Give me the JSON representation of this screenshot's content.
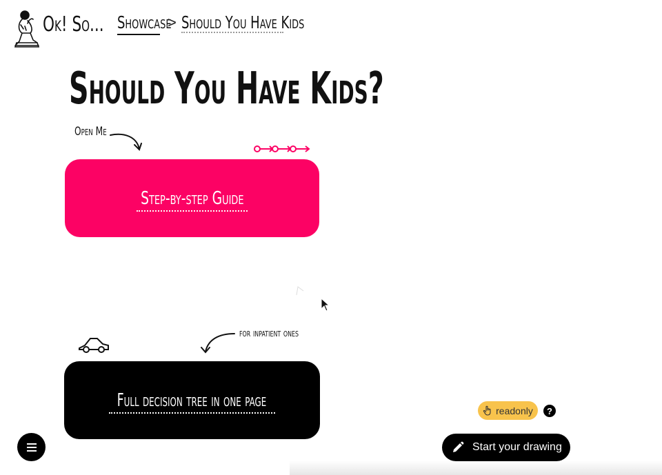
{
  "header": {
    "brand": "Ok! So...",
    "breadcrumb": {
      "showcase": "Showcase",
      "separator": ">",
      "current": "Should You Have Kids"
    }
  },
  "main": {
    "title": "Should You Have Kids?",
    "note_open": "Open Me",
    "note_impatient": "for inpatient ones",
    "guide_button": "Step-by-step Guide",
    "tree_button": "Full decision tree in one page"
  },
  "controls": {
    "readonly_label": "readonly",
    "help_label": "?",
    "draw_label": "Start your drawing"
  },
  "colors": {
    "accent": "#fc0264",
    "readonly_bg": "#f8c34c",
    "dark": "#000000"
  }
}
